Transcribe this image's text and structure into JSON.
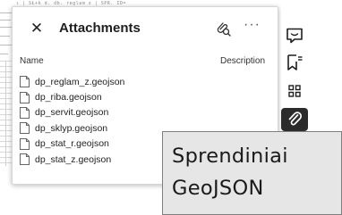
{
  "background_document": {
    "header_scribble": "ι | SŁ+k d. db. reglam z | SPR. ID=",
    "left_scribble": "AUTH"
  },
  "panel": {
    "title": "Attachments",
    "close_icon": "close-icon",
    "attach_icon": "paperclip-search-icon",
    "more_label": "···",
    "columns": {
      "name": "Name",
      "description": "Description"
    },
    "files": [
      {
        "name": "dp_reglam_z.geojson"
      },
      {
        "name": "dp_riba.geojson"
      },
      {
        "name": "dp_servit.geojson"
      },
      {
        "name": "dp_sklyp.geojson"
      },
      {
        "name": "dp_stat_r.geojson"
      },
      {
        "name": "dp_stat_z.geojson"
      }
    ]
  },
  "toolbar": {
    "tools": [
      {
        "icon": "comment-icon"
      },
      {
        "icon": "bookmark-list-icon"
      },
      {
        "icon": "thumbnails-icon"
      },
      {
        "icon": "attachment-icon",
        "active": true
      }
    ],
    "active_color": "#2b2b2b"
  },
  "caption": {
    "line1": "Sprendiniai",
    "line2": "GeoJSON",
    "background": "#e7e6e6"
  }
}
